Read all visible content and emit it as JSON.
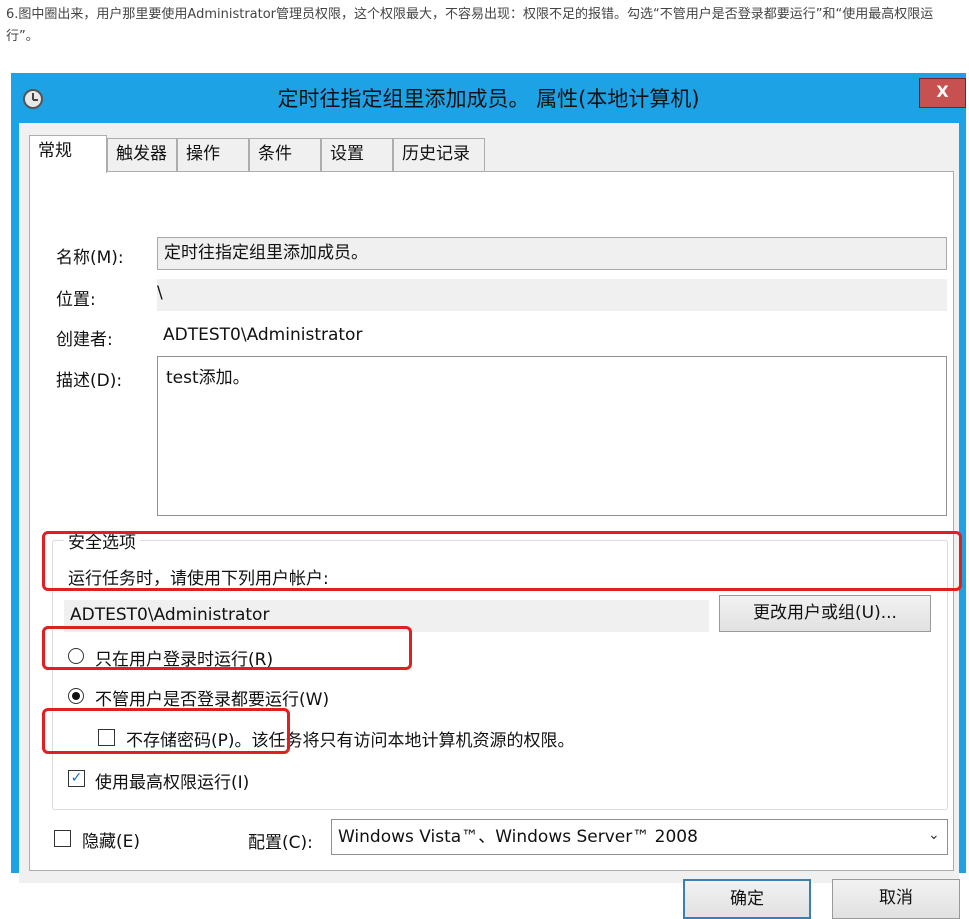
{
  "article": {
    "text": "6.图中圈出来，用户那里要使用Administrator管理员权限，这个权限最大，不容易出现：权限不足的报错。勾选“不管用户是否登录都要运行”和“使用最高权限运行”。"
  },
  "window": {
    "title": "定时往指定组里添加成员。 属性(本地计算机)",
    "close_label": "X",
    "title_bar_color": "#1ea2e6",
    "close_color": "#c75050"
  },
  "tabs": [
    {
      "label": "常规"
    },
    {
      "label": "触发器"
    },
    {
      "label": "操作"
    },
    {
      "label": "条件"
    },
    {
      "label": "设置"
    },
    {
      "label": "历史记录"
    }
  ],
  "general": {
    "name_label": "名称(M):",
    "name_value": "定时往指定组里添加成员。",
    "location_label": "位置:",
    "location_value": "\\",
    "author_label": "创建者:",
    "author_value": "ADTEST0\\Administrator",
    "description_label": "描述(D):",
    "description_value": "test添加。"
  },
  "security": {
    "group_title": "安全选项",
    "run_as_label": "运行任务时，请使用下列用户帐户:",
    "account_value": "ADTEST0\\Administrator",
    "change_user_button": "更改用户或组(U)...",
    "radio_logged_on": "只在用户登录时运行(R)",
    "radio_whether_logged_on": "不管用户是否登录都要运行(W)",
    "radio_selected": "whether_logged_on",
    "no_store_password": "不存储密码(P)。该任务将只有访问本地计算机资源的权限。",
    "no_store_password_checked": false,
    "highest_privileges": "使用最高权限运行(I)",
    "highest_privileges_checked": true
  },
  "footer": {
    "hidden_label": "隐藏(E)",
    "hidden_checked": false,
    "configure_label": "配置(C):",
    "configure_value": "Windows Vista™、Windows Server™ 2008",
    "ok_button": "确定",
    "cancel_button": "取消"
  },
  "annotations": {
    "highlight_color": "#e02020"
  }
}
